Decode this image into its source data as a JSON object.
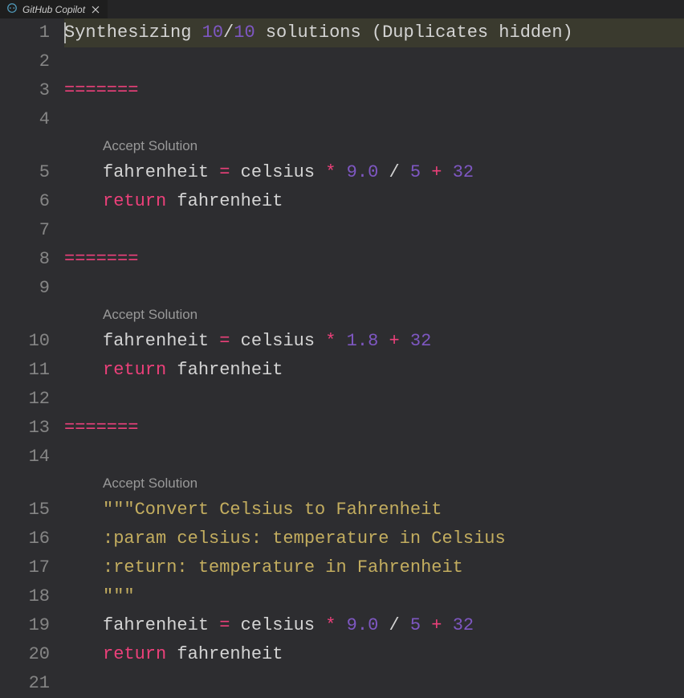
{
  "tab": {
    "title": "GitHub Copilot",
    "icon": "copilot-icon"
  },
  "editor": {
    "line_numbers": [
      "1",
      "2",
      "3",
      "4",
      "",
      "5",
      "6",
      "7",
      "8",
      "9",
      "",
      "10",
      "11",
      "12",
      "13",
      "14",
      "",
      "15",
      "16",
      "17",
      "18",
      "19",
      "20",
      "21"
    ],
    "status_line": {
      "prefix": "Synthesizing ",
      "count_done": "10",
      "slash": "/",
      "count_total": "10",
      "suffix": " solutions (Duplicates hidden)"
    },
    "separator": "=======",
    "codelens_label": "Accept Solution",
    "solutions": [
      {
        "lines": [
          [
            {
              "cls": "tk-ident",
              "t": "fahrenheit "
            },
            {
              "cls": "tk-op",
              "t": "="
            },
            {
              "cls": "tk-ident",
              "t": " celsius "
            },
            {
              "cls": "tk-op",
              "t": "*"
            },
            {
              "cls": "tk-ident",
              "t": " "
            },
            {
              "cls": "tk-number",
              "t": "9.0"
            },
            {
              "cls": "tk-ident",
              "t": " "
            },
            {
              "cls": "tk-slash",
              "t": "/"
            },
            {
              "cls": "tk-ident",
              "t": " "
            },
            {
              "cls": "tk-number",
              "t": "5"
            },
            {
              "cls": "tk-ident",
              "t": " "
            },
            {
              "cls": "tk-op",
              "t": "+"
            },
            {
              "cls": "tk-ident",
              "t": " "
            },
            {
              "cls": "tk-number",
              "t": "32"
            }
          ],
          [
            {
              "cls": "tk-keyword",
              "t": "return"
            },
            {
              "cls": "tk-ident",
              "t": " fahrenheit"
            }
          ]
        ]
      },
      {
        "lines": [
          [
            {
              "cls": "tk-ident",
              "t": "fahrenheit "
            },
            {
              "cls": "tk-op",
              "t": "="
            },
            {
              "cls": "tk-ident",
              "t": " celsius "
            },
            {
              "cls": "tk-op",
              "t": "*"
            },
            {
              "cls": "tk-ident",
              "t": " "
            },
            {
              "cls": "tk-number",
              "t": "1.8"
            },
            {
              "cls": "tk-ident",
              "t": " "
            },
            {
              "cls": "tk-op",
              "t": "+"
            },
            {
              "cls": "tk-ident",
              "t": " "
            },
            {
              "cls": "tk-number",
              "t": "32"
            }
          ],
          [
            {
              "cls": "tk-keyword",
              "t": "return"
            },
            {
              "cls": "tk-ident",
              "t": " fahrenheit"
            }
          ]
        ]
      },
      {
        "lines": [
          [
            {
              "cls": "tk-string",
              "t": "\"\"\"Convert Celsius to Fahrenheit"
            }
          ],
          [
            {
              "cls": "tk-string",
              "t": ":param celsius: temperature in Celsius"
            }
          ],
          [
            {
              "cls": "tk-string",
              "t": ":return: temperature in Fahrenheit"
            }
          ],
          [
            {
              "cls": "tk-string",
              "t": "\"\"\""
            }
          ],
          [
            {
              "cls": "tk-ident",
              "t": "fahrenheit "
            },
            {
              "cls": "tk-op",
              "t": "="
            },
            {
              "cls": "tk-ident",
              "t": " celsius "
            },
            {
              "cls": "tk-op",
              "t": "*"
            },
            {
              "cls": "tk-ident",
              "t": " "
            },
            {
              "cls": "tk-number",
              "t": "9.0"
            },
            {
              "cls": "tk-ident",
              "t": " "
            },
            {
              "cls": "tk-slash",
              "t": "/"
            },
            {
              "cls": "tk-ident",
              "t": " "
            },
            {
              "cls": "tk-number",
              "t": "5"
            },
            {
              "cls": "tk-ident",
              "t": " "
            },
            {
              "cls": "tk-op",
              "t": "+"
            },
            {
              "cls": "tk-ident",
              "t": " "
            },
            {
              "cls": "tk-number",
              "t": "32"
            }
          ],
          [
            {
              "cls": "tk-keyword",
              "t": "return"
            },
            {
              "cls": "tk-ident",
              "t": " fahrenheit"
            }
          ]
        ]
      }
    ]
  }
}
